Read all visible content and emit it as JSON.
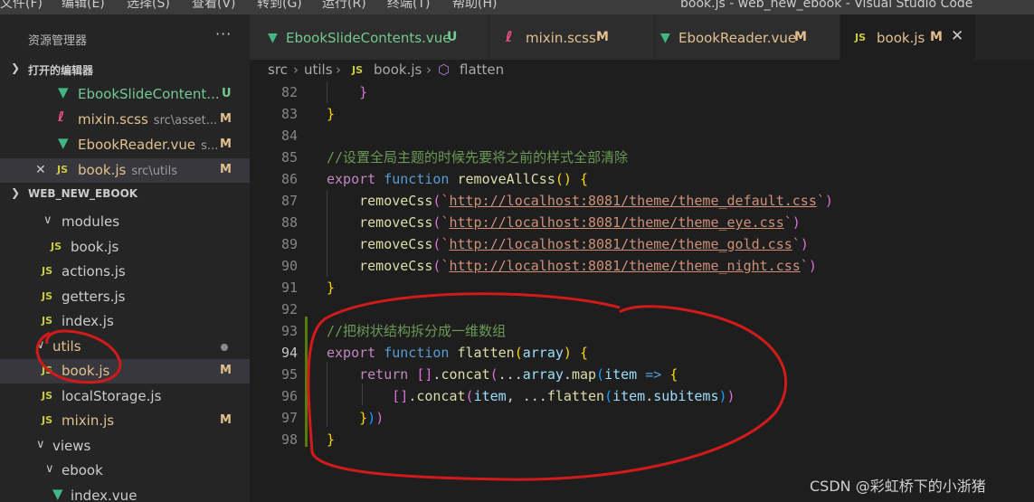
{
  "menu": [
    "文件(F)",
    "编辑(E)",
    "选择(S)",
    "查看(V)",
    "转到(G)",
    "运行(R)",
    "终端(T)",
    "帮助(H)"
  ],
  "window_title": "book.js - web_new_ebook - Visual Studio Code",
  "explorer": {
    "title": "资源管理器",
    "more": "···",
    "open_editors": {
      "label": "打开的编辑器",
      "items": [
        {
          "name": "EbookSlideContent...",
          "path": "",
          "badge": "U"
        },
        {
          "name": "mixin.scss",
          "path": "src\\asset...",
          "badge": "M"
        },
        {
          "name": "EbookReader.vue",
          "path": "s...",
          "badge": "M"
        },
        {
          "name": "book.js",
          "path": "src\\utils",
          "badge": "M"
        }
      ]
    },
    "project": {
      "label": "WEB_NEW_EBOOK",
      "tree": [
        "modules",
        "book.js",
        "actions.js",
        "getters.js",
        "index.js",
        "utils",
        "book.js",
        "localStorage.js",
        "mixin.js",
        "views",
        "ebook",
        "index.vue"
      ],
      "badges": {
        "book": "M",
        "mixin": "M"
      }
    }
  },
  "tabs": [
    {
      "icon": "V",
      "label": "EbookSlideContents.vue",
      "badge": "U"
    },
    {
      "icon": "S",
      "label": "mixin.scss",
      "badge": "M"
    },
    {
      "icon": "V",
      "label": "EbookReader.vue",
      "badge": "M"
    },
    {
      "icon": "JS",
      "label": "book.js",
      "badge": "M",
      "close": "✕"
    }
  ],
  "breadcrumb": [
    "src",
    "utils",
    "JS",
    "book.js",
    "flatten"
  ],
  "code": {
    "line_numbers": [
      "82",
      "83",
      "84",
      "85",
      "86",
      "87",
      "88",
      "89",
      "90",
      "91",
      "92",
      "93",
      "94",
      "95",
      "96",
      "97",
      "98"
    ],
    "comment1": "//设置全局主题的时候先要将之前的样式全部清除",
    "func1": "removeAllCss",
    "call": "removeCss",
    "urls": [
      "http://localhost:8081/theme/theme_default.css",
      "http://localhost:8081/theme/theme_eye.css",
      "http://localhost:8081/theme/theme_gold.css",
      "http://localhost:8081/theme/theme_night.css"
    ],
    "comment2": "//把树状结构拆分成一维数组",
    "func2": "flatten",
    "param": "array",
    "kw_export": "export",
    "kw_function": "function",
    "kw_return": "return",
    "concat": "concat",
    "map": "map",
    "item": "item",
    "subitems": "subitems"
  },
  "watermark": "CSDN @彩虹桥下的小浙猪",
  "colors": {
    "annotation": "#d11a1a",
    "accent_vue": "#41b883",
    "accent_js": "#cbcb41",
    "modified": "#e2c08d",
    "untracked": "#73c991"
  }
}
